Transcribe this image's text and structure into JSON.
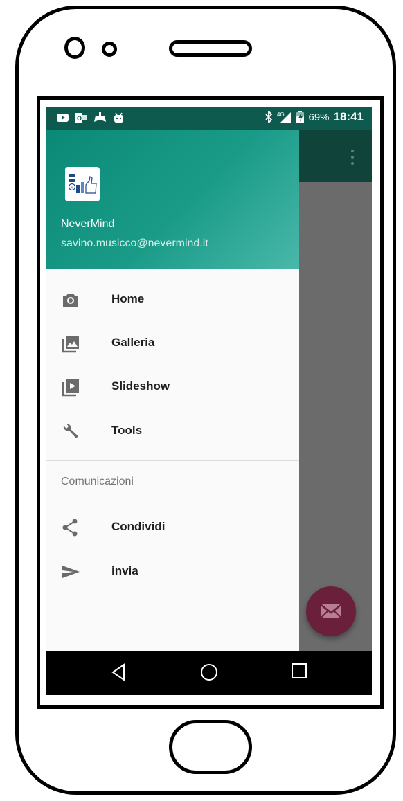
{
  "status_bar": {
    "battery_percent": "69%",
    "time": "18:41",
    "network": "4G",
    "icons_left": [
      "youtube-icon",
      "outlook-icon",
      "game-controller-icon",
      "android-icon"
    ],
    "icons_right": [
      "bluetooth-icon",
      "signal-4g-icon",
      "battery-charging-icon"
    ]
  },
  "drawer": {
    "header": {
      "name": "NeverMind",
      "email": "savino.musicco@nevermind.it"
    },
    "items": [
      {
        "label": "Home",
        "icon": "camera-icon"
      },
      {
        "label": "Galleria",
        "icon": "gallery-icon"
      },
      {
        "label": "Slideshow",
        "icon": "slideshow-icon"
      },
      {
        "label": "Tools",
        "icon": "wrench-icon"
      }
    ],
    "section_title": "Comunicazioni",
    "section_items": [
      {
        "label": "Condividi",
        "icon": "share-icon"
      },
      {
        "label": "invia",
        "icon": "send-icon"
      }
    ]
  },
  "colors": {
    "accent": "#0a8a76",
    "fab": "#6a1f3a",
    "toolbar": "#10443b"
  }
}
